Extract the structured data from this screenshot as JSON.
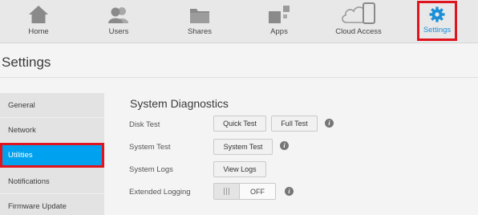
{
  "nav": {
    "home": "Home",
    "users": "Users",
    "shares": "Shares",
    "apps": "Apps",
    "cloud_access": "Cloud Access",
    "settings": "Settings"
  },
  "page_title": "Settings",
  "sidebar": {
    "items": [
      {
        "label": "General"
      },
      {
        "label": "Network"
      },
      {
        "label": "Utilities",
        "selected": true
      },
      {
        "label": "Notifications"
      },
      {
        "label": "Firmware Update"
      }
    ]
  },
  "main": {
    "section_title": "System Diagnostics",
    "disk_test": {
      "label": "Disk Test",
      "quick_button": "Quick Test",
      "full_button": "Full Test"
    },
    "system_test": {
      "label": "System Test",
      "button": "System Test"
    },
    "system_logs": {
      "label": "System Logs",
      "button": "View Logs"
    },
    "extended_logging": {
      "label": "Extended Logging",
      "state": "OFF"
    },
    "info_glyph": "i"
  },
  "colors": {
    "accent": "#1a8fd8",
    "selected_bg": "#00a1ee",
    "highlight_border": "#e0141e"
  }
}
